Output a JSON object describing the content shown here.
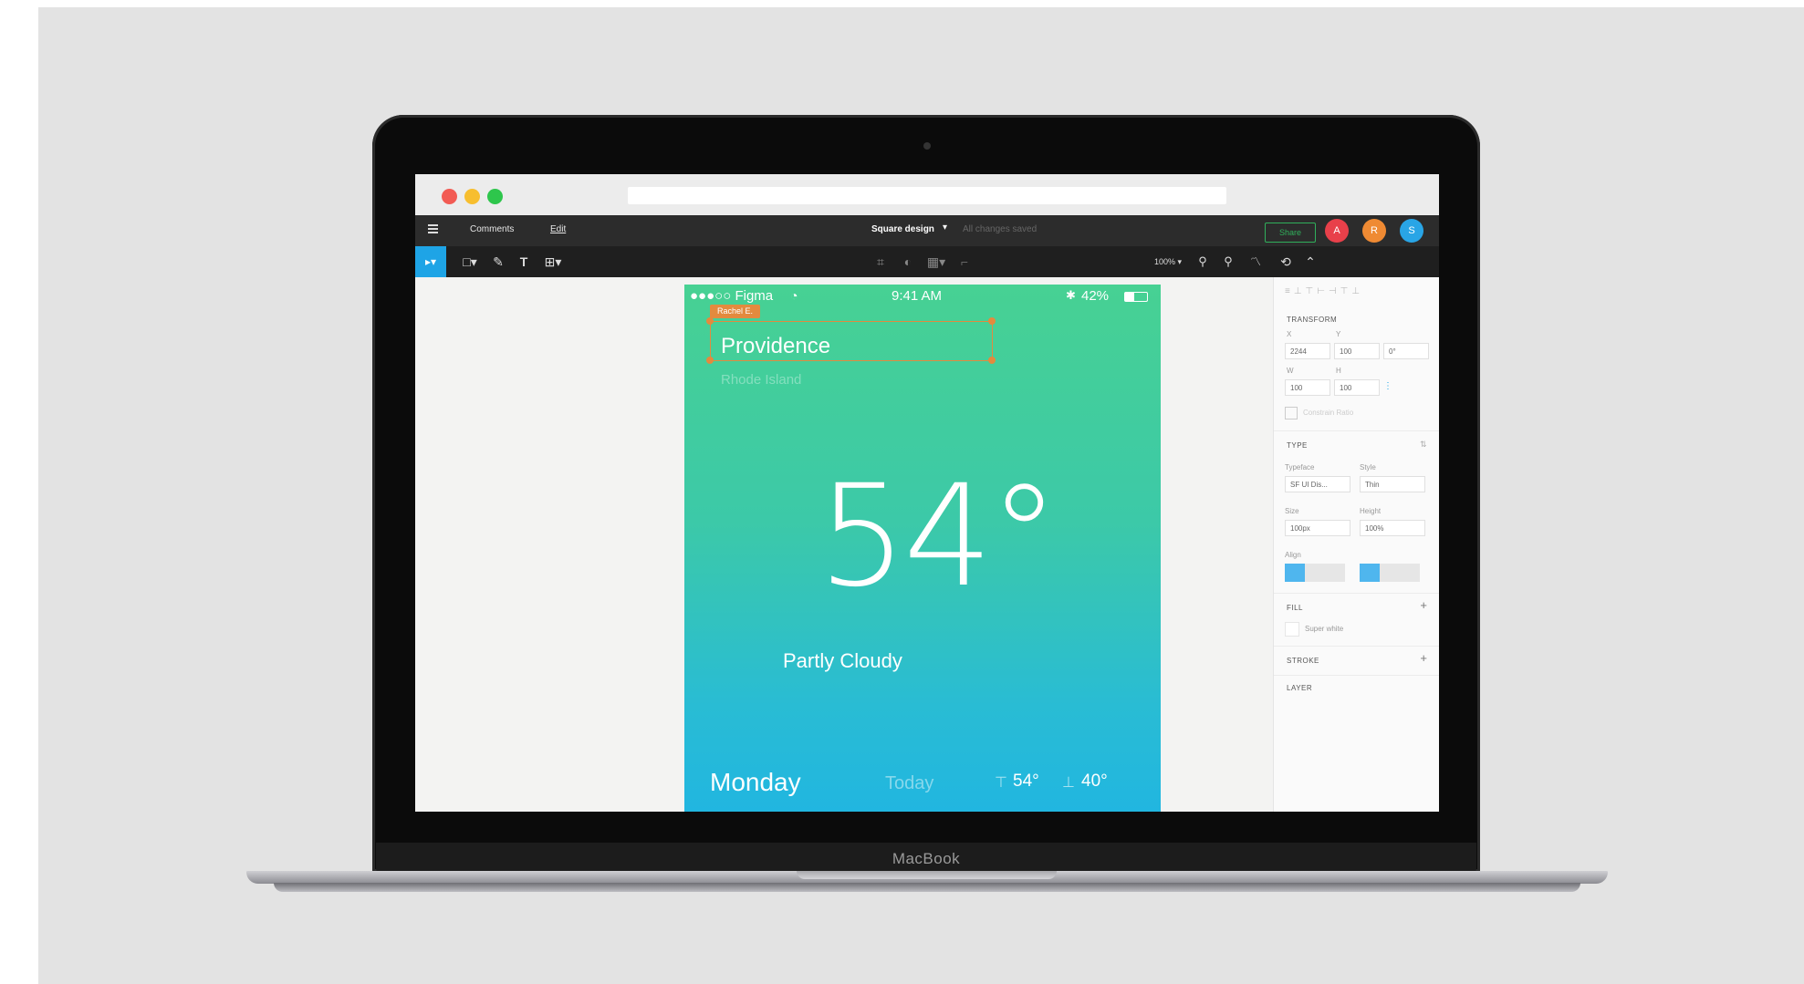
{
  "laptop": {
    "brand": "MacBook"
  },
  "figma": {
    "menu": {
      "comments": "Comments",
      "edit": "Edit"
    },
    "doc_title": "Square design",
    "doc_subtitle": "All changes saved",
    "share_label": "Share",
    "avatars": [
      {
        "initial": "A",
        "color": "#e8404a"
      },
      {
        "initial": "R",
        "color": "#ef8a33"
      },
      {
        "initial": "S",
        "color": "#29a5e6"
      }
    ],
    "zoom": "100%",
    "accent": "#1ea4e6"
  },
  "phone": {
    "status_carrier": "●●●○○ Figma",
    "status_time": "9:41 AM",
    "status_battery": "42%",
    "selection_tag": "Rachel E.",
    "city": "Providence",
    "state": "Rhode Island",
    "temperature": "54°",
    "condition": "Partly Cloudy",
    "day": "Monday",
    "today": "Today",
    "high": "54°",
    "low": "40°"
  },
  "panel": {
    "transform": "TRANSFORM",
    "x": "2244",
    "y": "100",
    "rotation": "0°",
    "w": "100",
    "h": "100",
    "constrain": "Constrain Ratio",
    "type": "TYPE",
    "typeface_label": "Typeface",
    "typeface_value": "SF UI Dis...",
    "style_label": "Style",
    "style_value": "Thin",
    "size_label": "Size",
    "size_value": "100px",
    "height_label": "Height",
    "height_value": "100%",
    "align_label": "Align",
    "fill": "FILL",
    "fill_value": "Super white",
    "stroke": "STROKE",
    "layer": "LAYER"
  }
}
